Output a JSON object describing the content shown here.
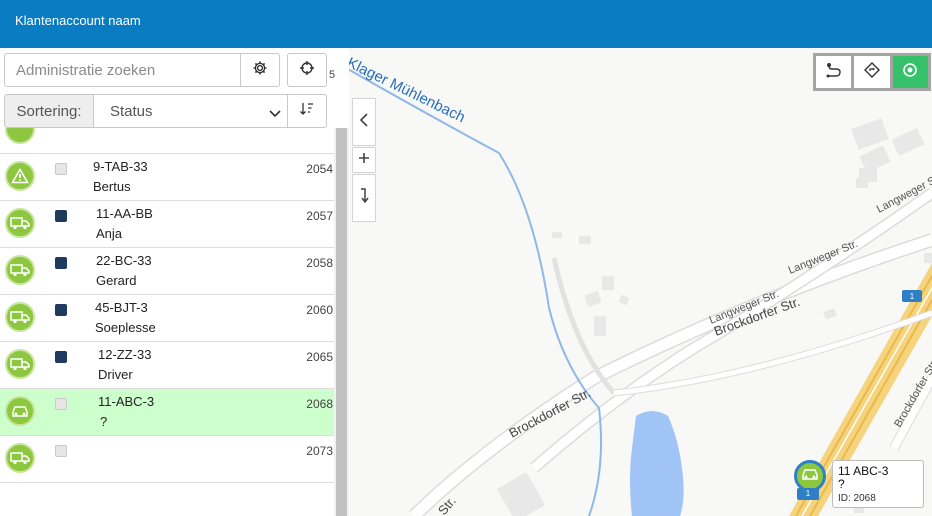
{
  "header": {
    "title": "Klantenaccount naam"
  },
  "search": {
    "placeholder": "Administratie zoeken"
  },
  "peek_numbers": [
    "5",
    "5"
  ],
  "sort": {
    "label": "Sortering:",
    "selected": "Status"
  },
  "vehicles": [
    {
      "plate": "9-TAB-33",
      "driver": "Bertus",
      "id": "2054",
      "status": "warning",
      "checked": false
    },
    {
      "plate": "11-AA-BB",
      "driver": "Anja",
      "id": "2057",
      "status": "truck",
      "checked": true
    },
    {
      "plate": "22-BC-33",
      "driver": "Gerard",
      "id": "2058",
      "status": "truck",
      "checked": true
    },
    {
      "plate": "45-BJT-3",
      "driver": "Soeplesse",
      "id": "2060",
      "status": "truck",
      "checked": true
    },
    {
      "plate": "12-ZZ-33",
      "driver": "Driver",
      "id": "2065",
      "status": "truck",
      "checked": true
    },
    {
      "plate": "11-ABC-3",
      "driver": "?",
      "id": "2068",
      "status": "car",
      "checked": false,
      "selected": true
    },
    {
      "plate": "",
      "driver": "",
      "id": "2073",
      "status": "truck",
      "checked": false
    }
  ],
  "map": {
    "streets": {
      "muhlenbach": "Klager Mühlenbach",
      "brockdorfer_1": "Brockdorfer Str.",
      "brockdorfer_2": "Brockdorfer Str.",
      "brockdorfer_3": "Brockdorfer Str.",
      "langweger_1": "Langweger Str.",
      "langweger_2": "Langweger Str.",
      "langweger_3": "Langweger Str.",
      "cut_str": "Str."
    },
    "road_shield": "1",
    "marker_tag": "1",
    "popup": {
      "plate": "11 ABC-3",
      "driver": "?",
      "id_text": "ID: 2068"
    }
  },
  "colors": {
    "header": "#0a7cc2",
    "status_green": "#8dc63f",
    "selected_row": "#ccffcc",
    "active_tool": "#35c06a"
  }
}
